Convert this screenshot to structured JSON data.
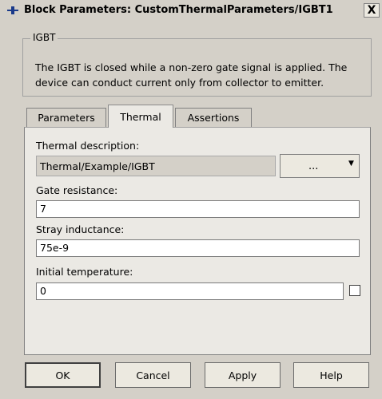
{
  "window": {
    "title": "Block Parameters: CustomThermalParameters/IGBT1",
    "close_glyph": "X"
  },
  "group": {
    "title": "IGBT",
    "description_line1": "The IGBT is closed while a non-zero gate signal is applied. The",
    "description_line2": "device can conduct current only from collector to emitter."
  },
  "tabs": [
    {
      "label": "Parameters",
      "active": false
    },
    {
      "label": "Thermal",
      "active": true
    },
    {
      "label": "Assertions",
      "active": false
    }
  ],
  "thermal": {
    "description_label": "Thermal description:",
    "description_value": "Thermal/Example/IGBT",
    "dropdown_label": "...",
    "gate_resistance_label": "Gate resistance:",
    "gate_resistance_value": "7",
    "stray_inductance_label": "Stray inductance:",
    "stray_inductance_value": "75e-9",
    "initial_temperature_label": "Initial temperature:",
    "initial_temperature_value": "0",
    "initial_temperature_checked": false
  },
  "buttons": {
    "ok": "OK",
    "cancel": "Cancel",
    "apply": "Apply",
    "help": "Help"
  }
}
